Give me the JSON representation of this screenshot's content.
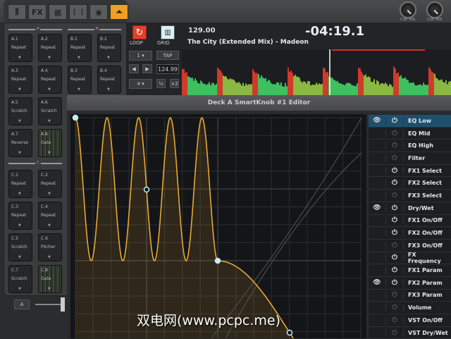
{
  "tabs": [
    {
      "icon": "mixer-icon",
      "label": ""
    },
    {
      "icon": "fx-icon",
      "label": "FX"
    },
    {
      "icon": "sampler-icon",
      "label": ""
    },
    {
      "icon": "eq-icon",
      "label": ""
    },
    {
      "icon": "video-icon",
      "label": ""
    },
    {
      "icon": "smartknob-curve-icon",
      "label": "",
      "active": true
    }
  ],
  "knobs": [
    {
      "label": "CUE VOL"
    },
    {
      "label": "CUE MIX"
    }
  ],
  "groups": {
    "a": "A",
    "b": "B",
    "c": "C"
  },
  "pads": [
    {
      "id": "A.1",
      "name": "Repeat"
    },
    {
      "id": "A.2",
      "name": "Repeat"
    },
    {
      "id": "B.1",
      "name": "Repeat"
    },
    {
      "id": "B.2",
      "name": "Repeat"
    },
    {
      "id": "A.3",
      "name": "Repeat"
    },
    {
      "id": "A.4",
      "name": "Repeat"
    },
    {
      "id": "B.3",
      "name": "Repeat"
    },
    {
      "id": "B.4",
      "name": "Repeat"
    },
    {
      "id": "A.5",
      "name": "Scratch"
    },
    {
      "id": "A.6",
      "name": "Scratch"
    },
    {
      "id": "A.7",
      "name": "Reverse"
    },
    {
      "id": "A.8",
      "name": "Gate"
    },
    {
      "id": "C.1",
      "name": "Repeat"
    },
    {
      "id": "C.2",
      "name": "Repeat"
    },
    {
      "id": "C.3",
      "name": "Repeat"
    },
    {
      "id": "C.4",
      "name": "Repeat"
    },
    {
      "id": "C.5",
      "name": "Scratch"
    },
    {
      "id": "C.6",
      "name": "Pitcher"
    },
    {
      "id": "C.7",
      "name": "Scratch"
    },
    {
      "id": "C.8",
      "name": "Gate"
    }
  ],
  "panel_footer": {
    "deck_button": "A"
  },
  "deck": {
    "loop_label": "LOOP",
    "grid_label": "GRID",
    "loop_size": "1",
    "beats": "4",
    "tap": "TAP",
    "bpm_edit": "124.99",
    "half": "½",
    "double": "×2",
    "bpm": "129.00",
    "time": "-04:19.1",
    "track": "The City (Extended Mix) - Madeon",
    "colors": {
      "loop": "#e0402a",
      "grid": "#d8f0f8",
      "accent": "#f0a020"
    }
  },
  "editor": {
    "title": "Deck A SmartKnob #1 Editor",
    "params": [
      {
        "label": "EQ Low",
        "visible": true,
        "on": true,
        "selected": true
      },
      {
        "label": "EQ Mid",
        "visible": false,
        "on": false
      },
      {
        "label": "EQ High",
        "visible": false,
        "on": false
      },
      {
        "label": "Filter",
        "visible": false,
        "on": false
      },
      {
        "label": "FX1 Select",
        "visible": false,
        "on": true
      },
      {
        "label": "FX2 Select",
        "visible": false,
        "on": true
      },
      {
        "label": "FX3 Select",
        "visible": false,
        "on": false
      },
      {
        "label": "Dry/Wet",
        "visible": true,
        "on": true
      },
      {
        "label": "FX1 On/Off",
        "visible": false,
        "on": true
      },
      {
        "label": "FX2 On/Off",
        "visible": false,
        "on": true
      },
      {
        "label": "FX3 On/Off",
        "visible": false,
        "on": false
      },
      {
        "label": "FX Frequency",
        "visible": false,
        "on": true
      },
      {
        "label": "FX1 Param",
        "visible": false,
        "on": true
      },
      {
        "label": "FX2 Param",
        "visible": true,
        "on": true
      },
      {
        "label": "FX3 Param",
        "visible": false,
        "on": false
      },
      {
        "label": "Volume",
        "visible": false,
        "on": false
      },
      {
        "label": "VST On/Off",
        "visible": false,
        "on": false
      },
      {
        "label": "VST Dry/Wet",
        "visible": false,
        "on": false
      }
    ]
  },
  "watermark": "双电网(www.pcpc.me)"
}
